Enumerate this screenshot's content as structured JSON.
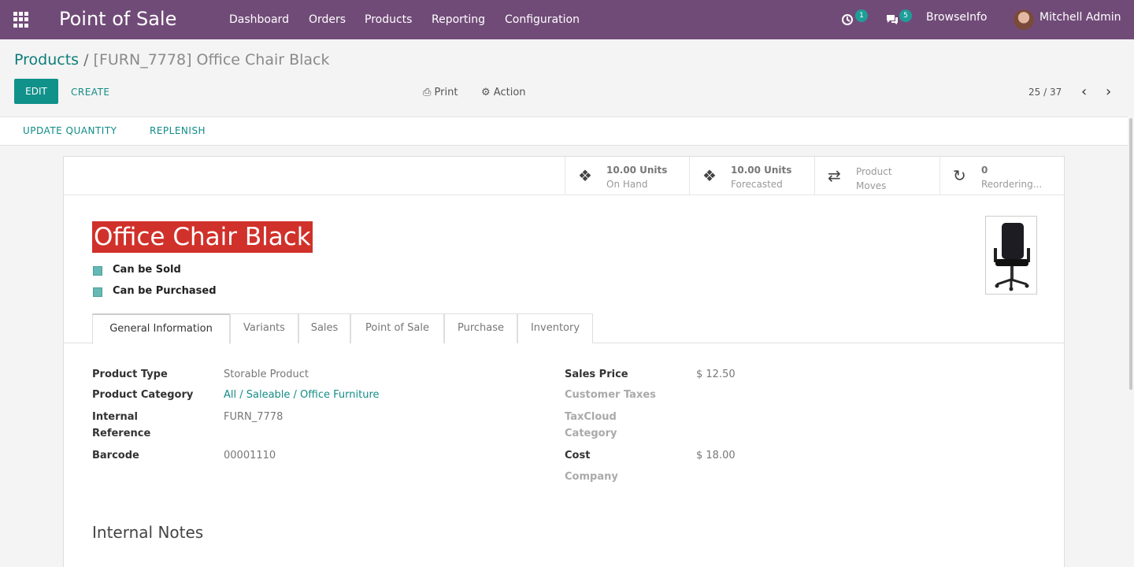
{
  "navbar": {
    "app_name": "Point of Sale",
    "menu": [
      "Dashboard",
      "Orders",
      "Products",
      "Reporting",
      "Configuration"
    ],
    "activity_badge": "1",
    "messages_badge": "5",
    "company": "BrowseInfo",
    "user": "Mitchell Admin"
  },
  "breadcrumb": {
    "parent": "Products",
    "separator": "/",
    "current": "[FURN_7778] Office Chair Black"
  },
  "control": {
    "edit_label": "EDIT",
    "create_label": "CREATE",
    "print_label": "Print",
    "action_label": "Action",
    "pager": "25 / 37"
  },
  "statusbar": {
    "update_quantity": "UPDATE QUANTITY",
    "replenish": "REPLENISH"
  },
  "stat_buttons": {
    "on_hand": {
      "value": "10.00 Units",
      "label": "On Hand"
    },
    "forecasted": {
      "value": "10.00 Units",
      "label": "Forecasted"
    },
    "moves": {
      "line1": "Product",
      "line2": "Moves"
    },
    "reordering": {
      "value": "0",
      "label": "Reordering..."
    }
  },
  "product": {
    "name": "Office Chair Black",
    "can_be_sold": "Can be Sold",
    "can_be_purchased": "Can be Purchased"
  },
  "tabs": [
    "General Information",
    "Variants",
    "Sales",
    "Point of Sale",
    "Purchase",
    "Inventory"
  ],
  "general": {
    "product_type_label": "Product Type",
    "product_type": "Storable Product",
    "category_label": "Product Category",
    "category": "All / Saleable / Office Furniture",
    "internal_ref_label_1": "Internal",
    "internal_ref_label_2": "Reference",
    "internal_ref": "FURN_7778",
    "barcode_label": "Barcode",
    "barcode": "00001110",
    "sales_price_label": "Sales Price",
    "sales_price": "$ 12.50",
    "customer_taxes_label": "Customer Taxes",
    "taxcloud_label_1": "TaxCloud",
    "taxcloud_label_2": "Category",
    "cost_label": "Cost",
    "cost": "$ 18.00",
    "company_label": "Company"
  },
  "notes_title": "Internal Notes"
}
